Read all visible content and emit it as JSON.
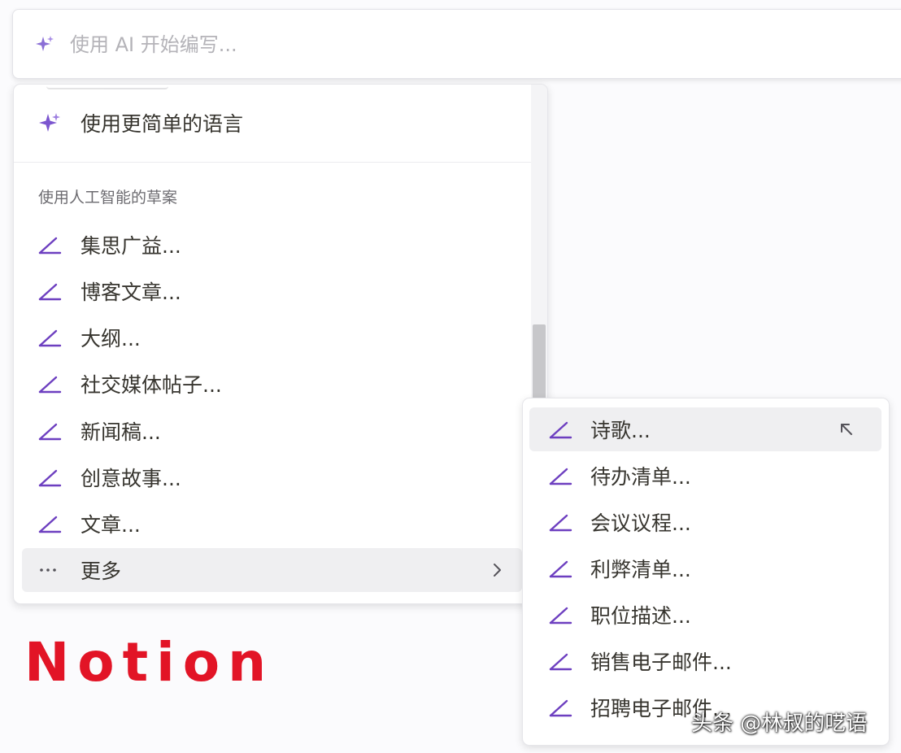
{
  "ai_bar": {
    "placeholder": "使用 AI 开始编写..."
  },
  "main_menu": {
    "simplify_label": "使用更简单的语言",
    "section_header": "使用人工智能的草案",
    "draft_items": [
      {
        "label": "集思广益..."
      },
      {
        "label": "博客文章..."
      },
      {
        "label": "大纲..."
      },
      {
        "label": "社交媒体帖子..."
      },
      {
        "label": "新闻稿..."
      },
      {
        "label": "创意故事..."
      },
      {
        "label": "文章..."
      }
    ],
    "more_label": "更多"
  },
  "submenu": {
    "items": [
      {
        "label": "诗歌..."
      },
      {
        "label": "待办清单..."
      },
      {
        "label": "会议议程..."
      },
      {
        "label": "利弊清单..."
      },
      {
        "label": "职位描述..."
      },
      {
        "label": "销售电子邮件..."
      },
      {
        "label": "招聘电子邮件..."
      }
    ]
  },
  "brand_caption": "Notion",
  "watermark": "头条 @林叔的呓语",
  "colors": {
    "accent_purple": "#6d3fc0",
    "caption_red": "#e21426",
    "hover_bg": "#efeff1"
  },
  "icons": {
    "ai": "sparkle-icon",
    "draft": "pen-line-icon",
    "more": "ellipsis-icon",
    "submenu": "chevron-right-icon",
    "pointer": "cursor-arrow-icon"
  }
}
